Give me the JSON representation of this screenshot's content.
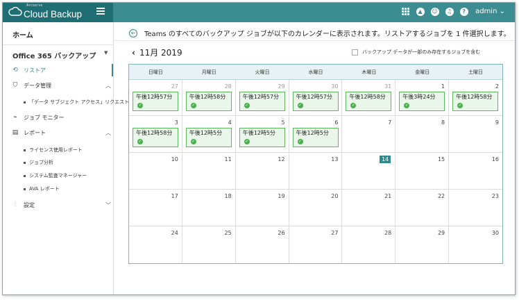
{
  "app": {
    "logo_small": "Arcserve",
    "logo_name": "Cloud Backup",
    "user": "admin"
  },
  "sidebar": {
    "home": "ホーム",
    "product": "Office 365 バックアップ",
    "items": [
      {
        "label": "リストア",
        "icon": "restore-icon"
      },
      {
        "label": "データ管理",
        "icon": "shield-icon"
      },
      {
        "label": "「データ サブジェクト アクセス」リクエスト"
      },
      {
        "label": "ジョブ モニター",
        "icon": "monitor-icon"
      },
      {
        "label": "レポート",
        "icon": "report-icon"
      },
      {
        "label": "ライセンス使用レポート"
      },
      {
        "label": "ジョブ分析"
      },
      {
        "label": "システム監査マネージャー"
      },
      {
        "label": "AVA レポート"
      },
      {
        "label": "設定",
        "icon": "settings-icon"
      }
    ]
  },
  "main": {
    "header": "Teams のすべてのバックアップ ジョブが以下のカレンダーに表示されます。リストアするジョブを 1 件選択します。",
    "month": "11月 2019",
    "checkbox_label": "バックアップ データが一部のみ存在するジョブを含む"
  },
  "calendar": {
    "weekdays": [
      "日曜日",
      "月曜日",
      "火曜日",
      "水曜日",
      "木曜日",
      "金曜日",
      "土曜日"
    ],
    "days": [
      {
        "n": "27",
        "prev": true,
        "event": "午後12時57分"
      },
      {
        "n": "28",
        "prev": true,
        "event": "午後12時58分"
      },
      {
        "n": "29",
        "prev": true,
        "event": "午後12時57分"
      },
      {
        "n": "30",
        "prev": true,
        "event": "午後12時57分"
      },
      {
        "n": "31",
        "prev": true,
        "event": "午後12時58分"
      },
      {
        "n": "1",
        "event": "午後3時24分"
      },
      {
        "n": "2",
        "event": "午後12時58分"
      },
      {
        "n": "3",
        "event": "午後12時58分"
      },
      {
        "n": "4",
        "event": "午後12時5分"
      },
      {
        "n": "5",
        "event": "午後12時5分"
      },
      {
        "n": "6",
        "event": "午後12時5分"
      },
      {
        "n": "7"
      },
      {
        "n": "8"
      },
      {
        "n": "9"
      },
      {
        "n": "10"
      },
      {
        "n": "11"
      },
      {
        "n": "12"
      },
      {
        "n": "13"
      },
      {
        "n": "14",
        "today": true
      },
      {
        "n": "15"
      },
      {
        "n": "16"
      },
      {
        "n": "17"
      },
      {
        "n": "18"
      },
      {
        "n": "19"
      },
      {
        "n": "20"
      },
      {
        "n": "21"
      },
      {
        "n": "22"
      },
      {
        "n": "23"
      },
      {
        "n": "24"
      },
      {
        "n": "25"
      },
      {
        "n": "26"
      },
      {
        "n": "27"
      },
      {
        "n": "28"
      },
      {
        "n": "29"
      },
      {
        "n": "30"
      }
    ]
  },
  "colors": {
    "topbar": "#3b8d91",
    "logo_bg": "#1e6e73",
    "accent": "#2f8a8e",
    "event_border": "#5cb85c"
  }
}
